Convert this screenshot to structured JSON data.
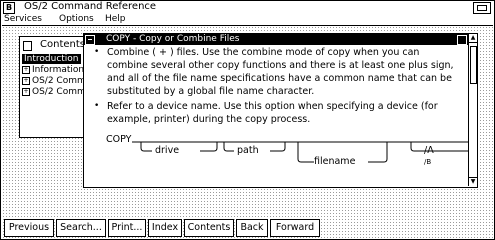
{
  "app": {
    "title": "OS/2 Command Reference",
    "system_icon_letter": "B"
  },
  "menu": [
    "Services",
    "Options",
    "Help"
  ],
  "contents": {
    "title": "Contents",
    "items": [
      {
        "label": "Introduction",
        "expander": "",
        "selected": true
      },
      {
        "label": "Information",
        "expander": "+",
        "selected": false
      },
      {
        "label": "OS/2 Comma",
        "expander": "+",
        "selected": false
      },
      {
        "label": "OS/2 Comma",
        "expander": "+",
        "selected": false
      }
    ]
  },
  "panel": {
    "title": "COPY - Copy or Combine Files",
    "para1": "Combine ( + ) files. Use the combine mode of copy when you can combine several other copy functions and there is at least one plus sign, and all of the file name specifications have a common name that can be substituted by a global file name character.",
    "para2": "Refer to a device name. Use this option when specifying a device (for example, printer) during the copy process.",
    "bullet": "•",
    "syntax": {
      "command": "COPY",
      "drive": "drive",
      "path": "path",
      "filename": "filename",
      "option": "/A",
      "option_sub": "/B"
    }
  },
  "buttons": [
    "Previous",
    "Search...",
    "Print...",
    "Index",
    "Contents",
    "Back",
    "Forward"
  ]
}
